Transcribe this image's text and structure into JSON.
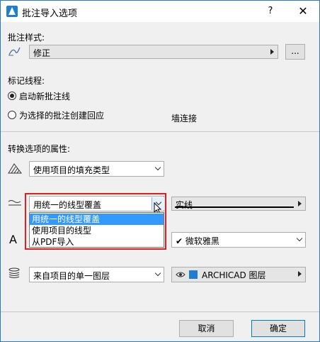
{
  "window": {
    "title": "批注导入选项",
    "help": "?",
    "close": "✕"
  },
  "markup_style": {
    "label": "批注样式:",
    "value": "修正",
    "more": "..."
  },
  "markup_line": {
    "label": "标记线程:",
    "option1": "启动新批注线",
    "option2": "为选择的批注创建回应",
    "wall_join": "墙连接"
  },
  "convert": {
    "label": "转换选项的属性:",
    "fill_select": "使用项目的填充类型",
    "line_select": "用统一的线型覆盖",
    "line_type": "实线",
    "font": "微软雅黑",
    "font_check": "✔",
    "layer_select": "来自项目的单一图层",
    "layer_value": "ARCHICAD 图层"
  },
  "dropdown": {
    "options": [
      "用统一的线型覆盖",
      "使用项目的线型",
      "从PDF导入"
    ],
    "selected": 0
  },
  "buttons": {
    "cancel": "取消",
    "ok": "确定"
  },
  "colors": {
    "accent": "#3399ff",
    "highlight": "#e02020",
    "border": "#2b79c2"
  }
}
